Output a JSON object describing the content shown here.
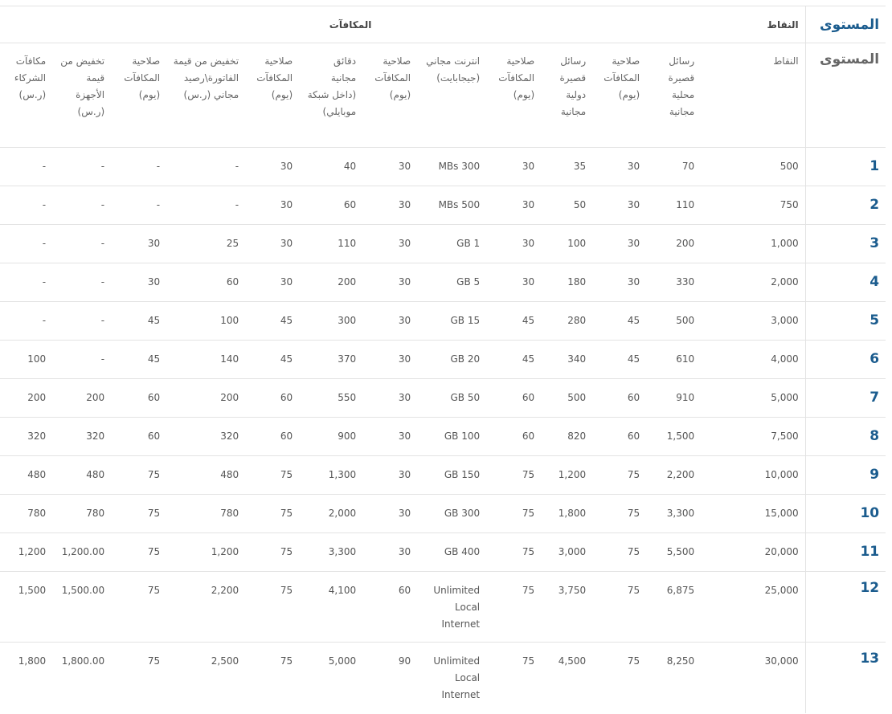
{
  "header": {
    "level": "المستوى",
    "points": "النقاط",
    "rewards": "المكافآت"
  },
  "columns": [
    "المستوى",
    "النقاط",
    "رسائل قصيرة محلية مجانية",
    "صلاحية المكافآت (يوم)",
    "رسائل قصيرة دولية مجانية",
    "صلاحية المكافآت (يوم)",
    "انترنت مجاني (جيجابايت)",
    "صلاحية المكافآت (يوم)",
    "دقائق مجانية (داخل شبكة موبايلي)",
    "صلاحية المكافآت (يوم)",
    "تخفيض من قيمة الفاتورة\\رصيد مجاني (ر.س)",
    "صلاحية المكافآت (يوم)",
    "تخفيض من قيمة الأجهزة (ر.س)",
    "مكافآت الشركاء (ر.س)"
  ],
  "rows": [
    [
      "1",
      "500",
      "70",
      "30",
      "35",
      "30",
      "300 MBs",
      "30",
      "40",
      "30",
      "-",
      "-",
      "-",
      "-"
    ],
    [
      "2",
      "750",
      "110",
      "30",
      "50",
      "30",
      "500 MBs",
      "30",
      "60",
      "30",
      "-",
      "-",
      "-",
      "-"
    ],
    [
      "3",
      "1,000",
      "200",
      "30",
      "100",
      "30",
      "1 GB",
      "30",
      "110",
      "30",
      "25",
      "30",
      "-",
      "-"
    ],
    [
      "4",
      "2,000",
      "330",
      "30",
      "180",
      "30",
      "5 GB",
      "30",
      "200",
      "30",
      "60",
      "30",
      "-",
      "-"
    ],
    [
      "5",
      "3,000",
      "500",
      "45",
      "280",
      "45",
      "15 GB",
      "30",
      "300",
      "45",
      "100",
      "45",
      "-",
      "-"
    ],
    [
      "6",
      "4,000",
      "610",
      "45",
      "340",
      "45",
      "20 GB",
      "30",
      "370",
      "45",
      "140",
      "45",
      "-",
      "100"
    ],
    [
      "7",
      "5,000",
      "910",
      "60",
      "500",
      "60",
      "50 GB",
      "30",
      "550",
      "60",
      "200",
      "60",
      "200",
      "200"
    ],
    [
      "8",
      "7,500",
      "1,500",
      "60",
      "820",
      "60",
      "100 GB",
      "30",
      "900",
      "60",
      "320",
      "60",
      "320",
      "320"
    ],
    [
      "9",
      "10,000",
      "2,200",
      "75",
      "1,200",
      "75",
      "150 GB",
      "30",
      "1,300",
      "75",
      "480",
      "75",
      "480",
      "480"
    ],
    [
      "10",
      "15,000",
      "3,300",
      "75",
      "1,800",
      "75",
      "300 GB",
      "30",
      "2,000",
      "75",
      "780",
      "75",
      "780",
      "780"
    ],
    [
      "11",
      "20,000",
      "5,500",
      "75",
      "3,000",
      "75",
      "400 GB",
      "30",
      "3,300",
      "75",
      "1,200",
      "75",
      "1,200.00",
      "1,200"
    ],
    [
      "12",
      "25,000",
      "6,875",
      "75",
      "3,750",
      "75",
      "Unlimited Local Internet",
      "60",
      "4,100",
      "75",
      "2,200",
      "75",
      "1,500.00",
      "1,500"
    ],
    [
      "13",
      "30,000",
      "8,250",
      "75",
      "4,500",
      "75",
      "Unlimited Local Internet",
      "90",
      "5,000",
      "75",
      "2,500",
      "75",
      "1,800.00",
      "1,800"
    ]
  ],
  "colors": {
    "level": "#1b5c8e",
    "text": "#555555",
    "border": "#e3e3e3"
  }
}
